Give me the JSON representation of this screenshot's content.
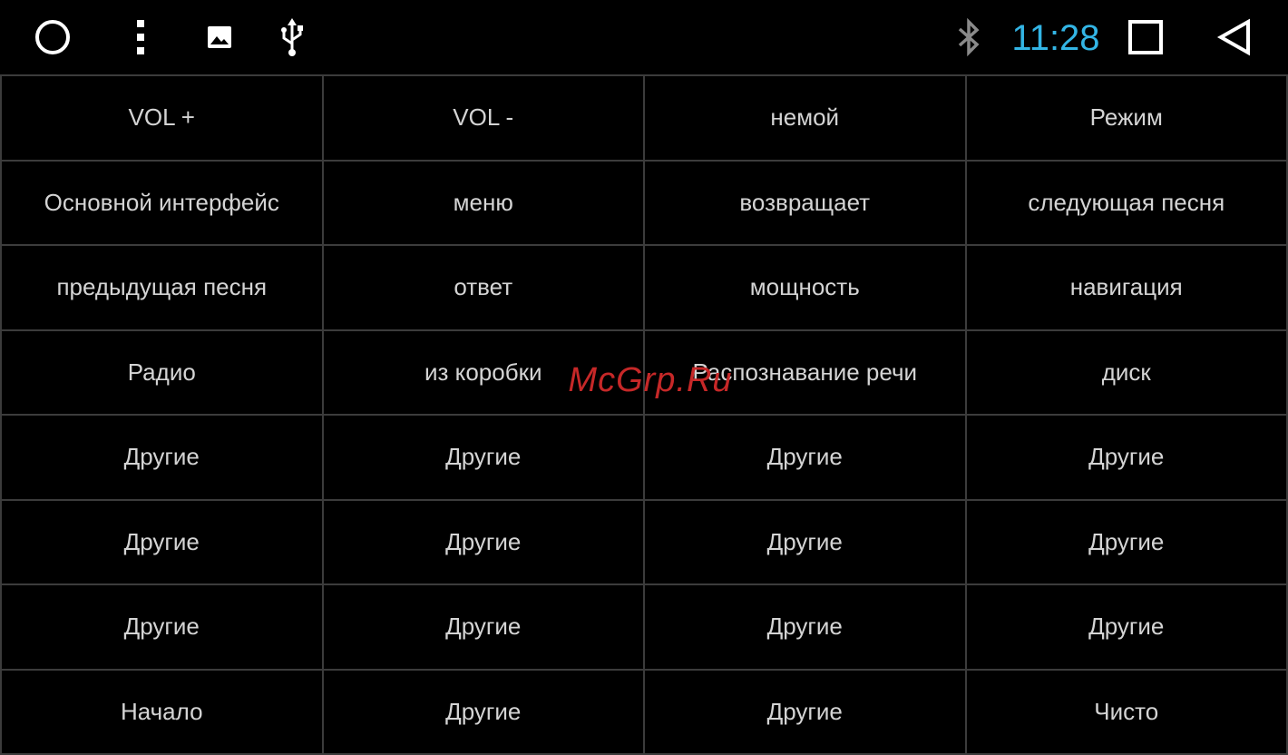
{
  "status_bar": {
    "time": "11:28",
    "colors": {
      "time": "#33b5e5",
      "bluetooth": "#8a8a8a",
      "icons": "#ffffff"
    },
    "icons": {
      "home": "home-circle-icon",
      "menu": "overflow-menu-icon",
      "gallery": "image-icon",
      "usb": "usb-icon",
      "bluetooth": "bluetooth-icon",
      "recent": "recent-apps-square-icon",
      "back": "back-triangle-icon"
    }
  },
  "watermark": "McGrp.Ru",
  "grid": {
    "rows": [
      [
        "VOL +",
        "VOL -",
        "немой",
        "Режим"
      ],
      [
        "Основной интерфейс",
        "меню",
        "возвращает",
        "следующая песня"
      ],
      [
        "предыдущая песня",
        "ответ",
        "мощность",
        "навигация"
      ],
      [
        "Радио",
        "из коробки",
        "Распознавание речи",
        "диск"
      ],
      [
        "Другие",
        "Другие",
        "Другие",
        "Другие"
      ],
      [
        "Другие",
        "Другие",
        "Другие",
        "Другие"
      ],
      [
        "Другие",
        "Другие",
        "Другие",
        "Другие"
      ],
      [
        "Начало",
        "Другие",
        "Другие",
        "Чисто"
      ]
    ]
  }
}
